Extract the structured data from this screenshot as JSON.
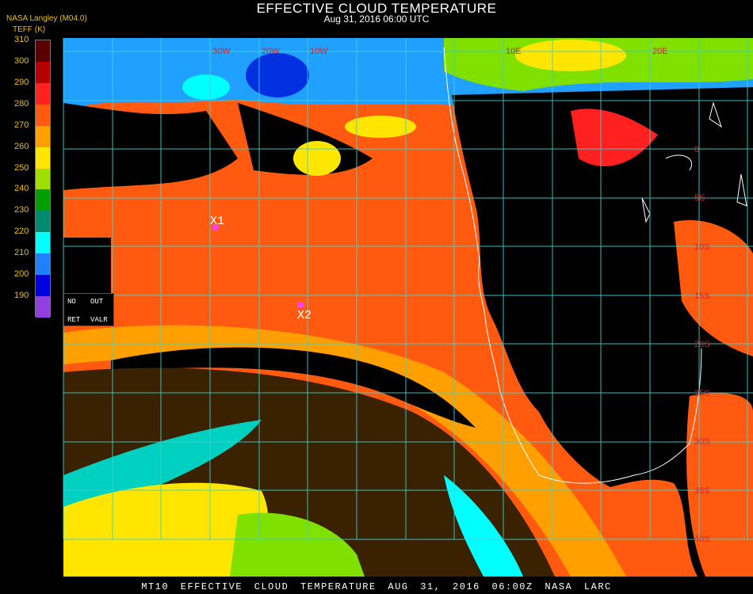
{
  "header": {
    "title": "EFFECTIVE CLOUD TEMPERATURE",
    "subtitle": "Aug 31, 2016 06:00 UTC",
    "producer": "NASA Langley (M04.0)",
    "units_label": "TEFF (K)"
  },
  "colorbar": {
    "labels": [
      "310",
      "300",
      "290",
      "280",
      "270",
      "260",
      "250",
      "240",
      "230",
      "220",
      "210",
      "200",
      "190"
    ],
    "colors": [
      "#5a0000",
      "#b40000",
      "#ff2020",
      "#ff5a10",
      "#ffa000",
      "#ffe600",
      "#a0e000",
      "#00a000",
      "#008a70",
      "#00ffff",
      "#2080ff",
      "#0000e0",
      "#9040e0"
    ]
  },
  "legend_box": {
    "no_label": "NO",
    "out_label": "OUT",
    "ret_label": "RET",
    "valr_label": "VALR"
  },
  "markers": [
    {
      "label": "X1",
      "color": "#ff40ff"
    },
    {
      "label": "X2",
      "color": "#ff40ff"
    }
  ],
  "map_labels": {
    "lat_labels": [
      "0",
      "5S",
      "10S",
      "15S",
      "20S",
      "25S",
      "30S",
      "35S",
      "40S"
    ],
    "lon_labels": [
      "30W",
      "20W",
      "10W",
      "10E",
      "20E"
    ]
  },
  "colors": {
    "grid": "#40d0d0",
    "coast": "#ffffff",
    "ocean_cloud": "#ff5a10",
    "clear": "#000000"
  },
  "footer": "MT10  EFFECTIVE CLOUD TEMPERATURE  AUG 31, 2016 06:00Z  NASA LARC"
}
